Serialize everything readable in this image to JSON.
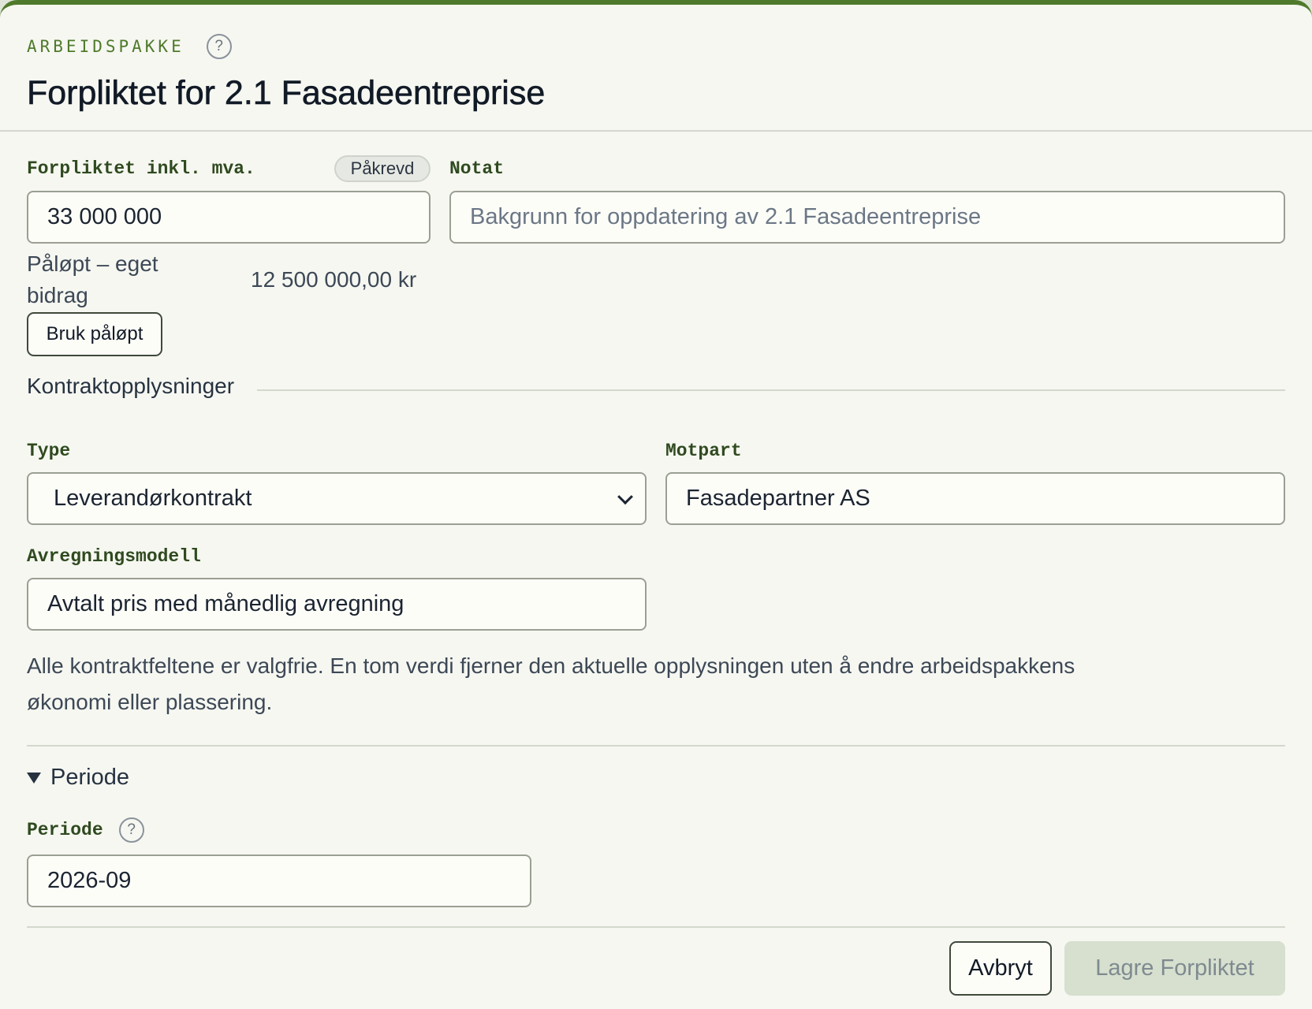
{
  "header": {
    "eyebrow": "ARBEIDSPAKKE",
    "help_glyph": "?",
    "title": "Forpliktet for 2.1 Fasadeentreprise"
  },
  "form": {
    "committed": {
      "label": "Forpliktet inkl. mva.",
      "required_badge": "Påkrevd",
      "value": "33 000 000"
    },
    "note": {
      "label": "Notat",
      "placeholder": "Bakgrunn for oppdatering av 2.1 Fasadeentreprise",
      "value": ""
    },
    "accrued": {
      "label_line1": "Påløpt – eget",
      "label_line2": "bidrag",
      "value": "12 500 000,00 kr",
      "use_button": "Bruk påløpt"
    }
  },
  "contract": {
    "section_title": "Kontraktopplysninger",
    "type": {
      "label": "Type",
      "value": "Leverandørkontrakt"
    },
    "counterparty": {
      "label": "Motpart",
      "value": "Fasadepartner AS"
    },
    "settlement": {
      "label": "Avregningsmodell",
      "value": "Avtalt pris med månedlig avregning"
    },
    "hint_line1": "Alle kontraktfeltene er valgfrie. En tom verdi fjerner den aktuelle opplysningen uten å endre arbeidspakkens",
    "hint_line2": "økonomi eller plassering."
  },
  "period": {
    "disclosure_title": "Periode",
    "label": "Periode",
    "help_glyph": "?",
    "value": "2026-09"
  },
  "footer": {
    "cancel_label": "Avbryt",
    "save_label": "Lagre Forpliktet"
  },
  "colors": {
    "accent": "#4f7a2b",
    "label": "#2f4a1f",
    "background": "#f6f7f1",
    "disabled_button": "#d7dfcf"
  }
}
